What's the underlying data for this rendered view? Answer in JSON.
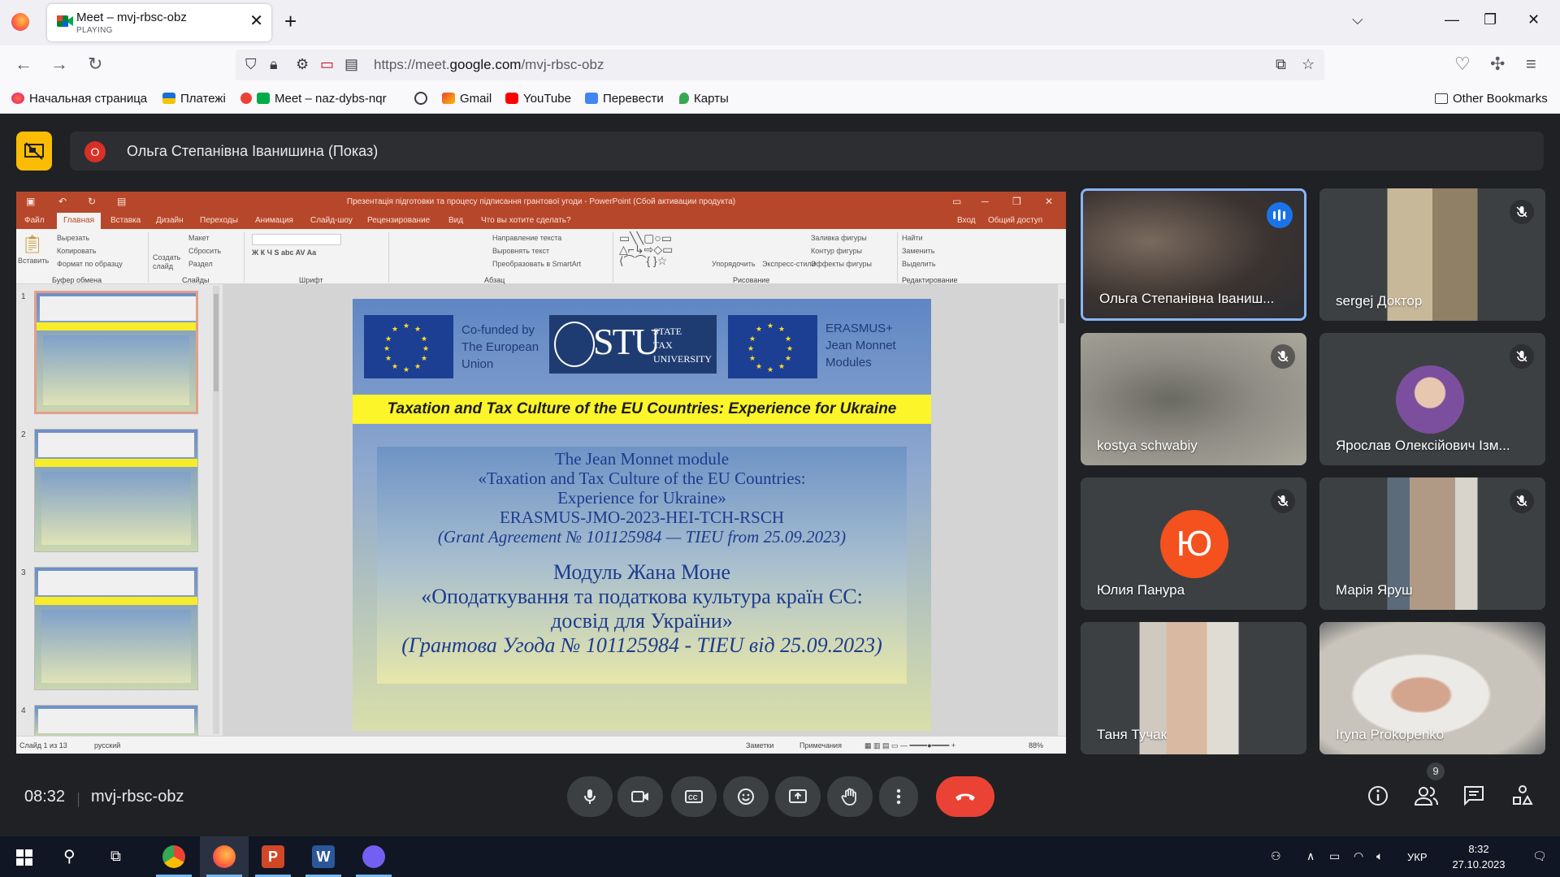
{
  "browser": {
    "tab_title": "Meet – mvj-rbsc-obz",
    "tab_status": "PLAYING",
    "url_prefix": "https://meet.",
    "url_domain": "google.com",
    "url_path": "/mvj-rbsc-obz",
    "bookmarks": [
      "Начальная страница",
      "Платежі",
      "Meet – naz-dybs-nqr",
      "Gmail",
      "YouTube",
      "Перевести",
      "Карты"
    ],
    "other_bookmarks": "Other Bookmarks"
  },
  "meet": {
    "presenter_initial": "О",
    "presenter_label": "Ольга Степанівна Іванишина (Показ)",
    "time": "08:32",
    "meeting_code": "mvj-rbsc-obz",
    "participants_count": "9",
    "tiles": [
      {
        "name": "Ольга Степанівна Іваниш...",
        "speaking": true
      },
      {
        "name": "sergej Доктор",
        "muted": true
      },
      {
        "name": "kostya schwabiy",
        "muted": true
      },
      {
        "name": "Ярослав Олексійович Ізм...",
        "muted": true
      },
      {
        "name": "Юлия Панура",
        "initial": "Ю",
        "muted": true
      },
      {
        "name": "Марія Яруш",
        "muted": true
      },
      {
        "name": "Таня Тучак"
      },
      {
        "name": "Iryna Prokopenko"
      }
    ]
  },
  "ppt": {
    "title": "Презентація підготовки та процесу підписання грантової угоди - PowerPoint (Сбой активации продукта)",
    "tabs": [
      "Файл",
      "Главная",
      "Вставка",
      "Дизайн",
      "Переходы",
      "Анимация",
      "Слайд-шоу",
      "Рецензирование",
      "Вид",
      "Что вы хотите сделать?"
    ],
    "login": "Вход",
    "share": "Общий доступ",
    "groups": [
      "Буфер обмена",
      "Слайды",
      "Шрифт",
      "Абзац",
      "Рисование",
      "Редактирование"
    ],
    "ribbon": {
      "paste": "Вставить",
      "cut": "Вырезать",
      "copy": "Копировать",
      "format": "Формат по образцу",
      "create_slide": "Создать слайд",
      "layout": "Макет",
      "reset": "Сбросить",
      "section": "Раздел",
      "text_dir": "Направление текста",
      "align_text": "Выровнять текст",
      "smartart": "Преобразовать в SmartArt",
      "arrange": "Упорядочить",
      "quick_styles": "Экспресс-стили",
      "fill": "Заливка фигуры",
      "outline": "Контур фигуры",
      "effects": "Эффекты фигуры",
      "find": "Найти",
      "replace": "Заменить",
      "select": "Выделить"
    },
    "status_slide": "Слайд 1 из 13",
    "status_lang": "русский",
    "notes": "Заметки",
    "comments": "Примечания",
    "zoom": "88%",
    "thumb_numbers": [
      "1",
      "2",
      "3",
      "4"
    ]
  },
  "slide": {
    "logo_left": [
      "Co-funded by",
      "The European",
      "Union"
    ],
    "stu_big": "STU",
    "stu_small": [
      "STATE",
      "TAX",
      "UNIVERSITY"
    ],
    "logo_right": [
      "ERASMUS+",
      "Jean Monnet",
      "Modules"
    ],
    "band": "Taxation and Tax Culture of the EU Countries: Experience for Ukraine",
    "lines": [
      "The Jean Monnet module",
      "«Taxation and Tax Culture of the EU Countries:",
      "Experience for Ukraine»",
      "ERASMUS-JMO-2023-HEI-TCH-RSCH",
      "(Grant Agreement № 101125984 — TIEU from 25.09.2023)",
      "Модуль Жана Моне",
      "«Оподаткування та податкова культура країн ЄС:",
      "досвід для України»",
      "(Грантова Угода №  101125984 - TIEU від 25.09.2023)"
    ]
  },
  "taskbar": {
    "lang": "УКР",
    "time": "8:32",
    "date": "27.10.2023"
  }
}
